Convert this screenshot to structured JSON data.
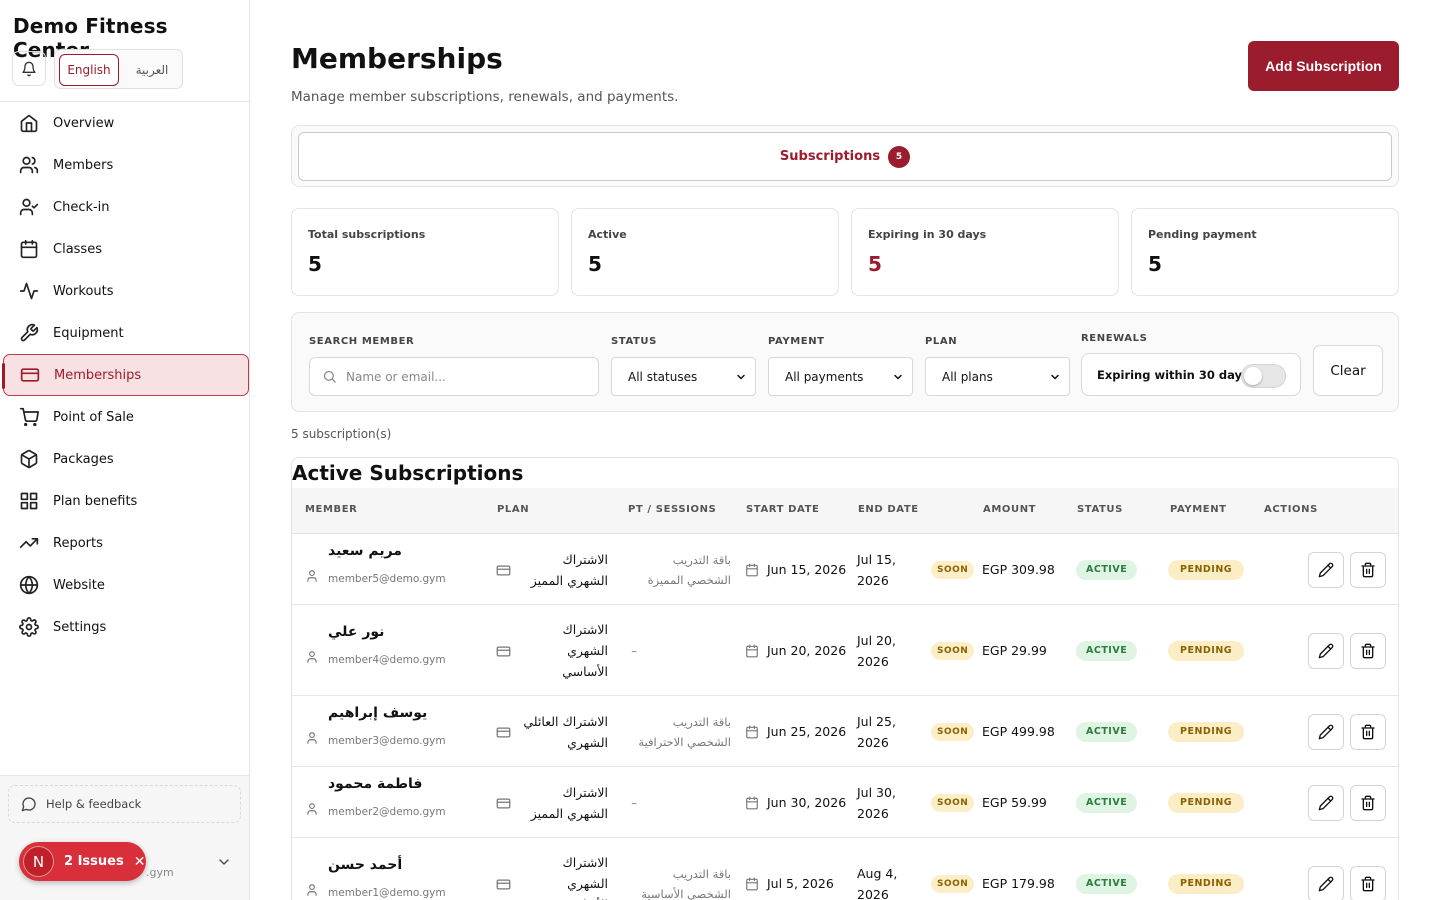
{
  "app": {
    "brand": "Demo Fitness Center",
    "lang_en": "English",
    "lang_ar": "العربية"
  },
  "nav": {
    "items": [
      {
        "label": "Overview",
        "icon": "home-icon"
      },
      {
        "label": "Members",
        "icon": "users-icon"
      },
      {
        "label": "Check-in",
        "icon": "user-check-icon"
      },
      {
        "label": "Classes",
        "icon": "calendar-icon"
      },
      {
        "label": "Workouts",
        "icon": "activity-icon"
      },
      {
        "label": "Equipment",
        "icon": "wrench-icon"
      },
      {
        "label": "Memberships",
        "icon": "credit-card-icon",
        "active": true
      },
      {
        "label": "Point of Sale",
        "icon": "cart-icon"
      },
      {
        "label": "Packages",
        "icon": "package-icon"
      },
      {
        "label": "Plan benefits",
        "icon": "grid-icon"
      },
      {
        "label": "Reports",
        "icon": "trending-up-icon"
      },
      {
        "label": "Website",
        "icon": "globe-icon"
      },
      {
        "label": "Settings",
        "icon": "gear-icon"
      }
    ],
    "help": "Help & feedback",
    "account_email_tail": ".gym"
  },
  "issues": {
    "avatar": "N",
    "label": "2 Issues",
    "close": "✕"
  },
  "header": {
    "title": "Memberships",
    "subtitle": "Manage member subscriptions, renewals, and payments.",
    "add_button": "Add Subscription"
  },
  "tabs": [
    {
      "label": "Subscriptions",
      "badge": "5"
    }
  ],
  "stats": [
    {
      "label": "Total subscriptions",
      "value": "5"
    },
    {
      "label": "Active",
      "value": "5"
    },
    {
      "label": "Expiring in 30 days",
      "value": "5"
    },
    {
      "label": "Pending payment",
      "value": "5"
    }
  ],
  "filters": {
    "search_label": "SEARCH MEMBER",
    "search_placeholder": "Name or email...",
    "status_label": "STATUS",
    "status_value": "All statuses",
    "payment_label": "PAYMENT",
    "payment_value": "All payments",
    "plan_label": "PLAN",
    "plan_value": "All plans",
    "renewals_label": "RENEWALS",
    "renewals_toggle_label": "Expiring within 30 days",
    "renewals_toggle_on": false,
    "clear": "Clear"
  },
  "results_count": "5 subscription(s)",
  "table": {
    "title": "Active Subscriptions",
    "columns": [
      "MEMBER",
      "PLAN",
      "PT / SESSIONS",
      "START DATE",
      "END DATE",
      "AMOUNT",
      "STATUS",
      "PAYMENT",
      "ACTIONS"
    ],
    "rows": [
      {
        "name": "مريم سعيد",
        "email": "member5@demo.gym",
        "plan": "الاشتراك الشهري المميز",
        "pt": "باقة التدريب الشخصي المميزة",
        "start": "Jun 15, 2026",
        "end": "Jul 15, 2026",
        "soon": "SOON",
        "amount": "EGP 309.98",
        "status": "ACTIVE",
        "payment": "PENDING"
      },
      {
        "name": "نور علي",
        "email": "member4@demo.gym",
        "plan": "الاشتراك الشهري الأساسي",
        "pt": "–",
        "start": "Jun 20, 2026",
        "end": "Jul 20, 2026",
        "soon": "SOON",
        "amount": "EGP 29.99",
        "status": "ACTIVE",
        "payment": "PENDING"
      },
      {
        "name": "يوسف إبراهيم",
        "email": "member3@demo.gym",
        "plan": "الاشتراك العائلي الشهري",
        "pt": "باقة التدريب الشخصي الاحترافية",
        "start": "Jun 25, 2026",
        "end": "Jul 25, 2026",
        "soon": "SOON",
        "amount": "EGP 499.98",
        "status": "ACTIVE",
        "payment": "PENDING"
      },
      {
        "name": "فاطمة محمود",
        "email": "member2@demo.gym",
        "plan": "الاشتراك الشهري المميز",
        "pt": "–",
        "start": "Jun 30, 2026",
        "end": "Jul 30, 2026",
        "soon": "SOON",
        "amount": "EGP 59.99",
        "status": "ACTIVE",
        "payment": "PENDING"
      },
      {
        "name": "أحمد حسن",
        "email": "member1@demo.gym",
        "plan": "الاشتراك الشهري الأساسي",
        "pt": "باقة التدريب الشخصي الأساسية",
        "start": "Jul 5, 2026",
        "end": "Aug 4, 2026",
        "soon": "SOON",
        "amount": "EGP 179.98",
        "status": "ACTIVE",
        "payment": "PENDING"
      }
    ]
  },
  "colors": {
    "brand": "#9b1c2c",
    "active_bg": "#f7e1e3",
    "status_active_bg": "#dff4e3",
    "payment_pending_bg": "#fbeec6"
  }
}
